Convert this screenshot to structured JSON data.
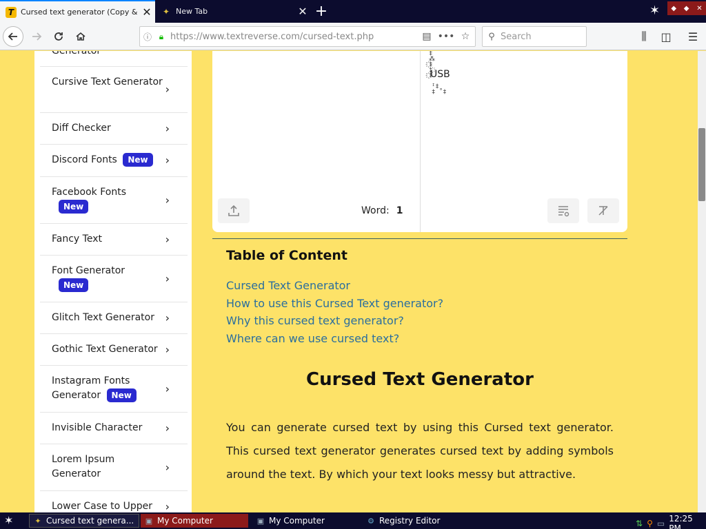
{
  "tabs": [
    {
      "favicon": "T",
      "title": "Cursed text generator (Copy & Pa"
    },
    {
      "favicon": "✦",
      "title": "New Tab"
    }
  ],
  "nav": {
    "url": "https://www.textreverse.com/cursed-text.php",
    "search_placeholder": "Search"
  },
  "sidebar": {
    "items": [
      {
        "label": "Generator",
        "badge": ""
      },
      {
        "label": "Cursive Text Generator",
        "badge": ""
      },
      {
        "label": "Diff Checker",
        "badge": ""
      },
      {
        "label": "Discord Fonts",
        "badge": "New"
      },
      {
        "label": "Facebook Fonts",
        "badge": "New"
      },
      {
        "label": "Fancy Text",
        "badge": ""
      },
      {
        "label": "Font Generator",
        "badge": "New"
      },
      {
        "label": "Glitch Text Generator",
        "badge": ""
      },
      {
        "label": "Gothic Text Generator",
        "badge": ""
      },
      {
        "label": "Instagram Fonts Generator",
        "badge": "New"
      },
      {
        "label": "Invisible Character",
        "badge": ""
      },
      {
        "label": "Lorem Ipsum Generator",
        "badge": ""
      },
      {
        "label": "Lower Case to Upper",
        "badge": ""
      }
    ]
  },
  "editor": {
    "word_label": "Word:",
    "word_count": "1",
    "output_visible_text": "USB"
  },
  "toc": {
    "title": "Table of Content",
    "links": [
      "Cursed Text Generator",
      "How to use this Cursed Text generator?",
      "Why this cursed text generator?",
      "Where can we use cursed text?"
    ]
  },
  "article": {
    "heading": "Cursed Text Generator",
    "paragraph": "You can generate cursed text by using this Cursed text generator. This cursed text generator generates cursed text by adding symbols around the text. By which your text looks messy but attractive."
  },
  "taskbar": {
    "items": [
      {
        "label": "Cursed text genera..."
      },
      {
        "label": "My Computer"
      },
      {
        "label": "My Computer"
      },
      {
        "label": "Registry Editor"
      }
    ],
    "clock": "12:25 PM"
  }
}
